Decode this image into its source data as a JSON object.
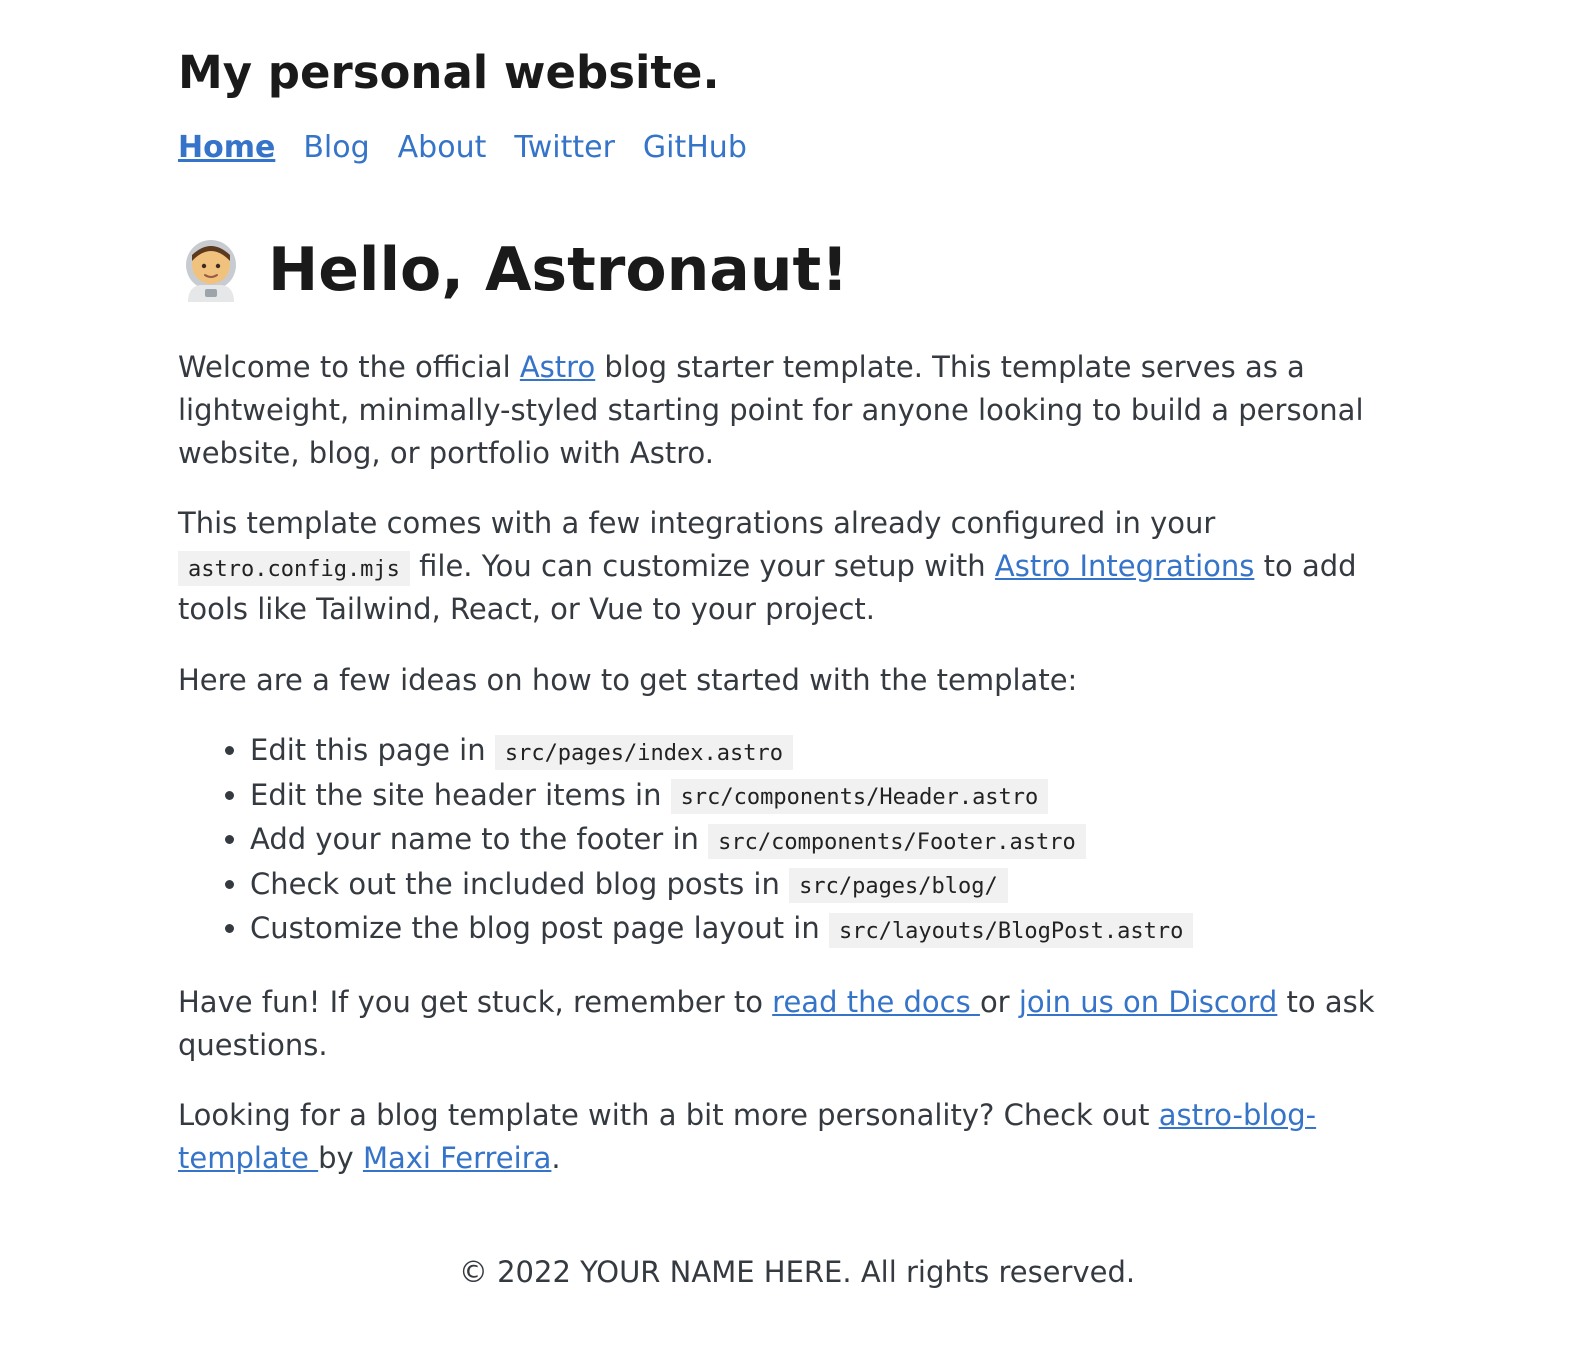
{
  "site": {
    "title": "My personal website."
  },
  "nav": {
    "items": [
      {
        "label": "Home",
        "active": true
      },
      {
        "label": "Blog",
        "active": false
      },
      {
        "label": "About",
        "active": false
      },
      {
        "label": "Twitter",
        "active": false
      },
      {
        "label": "GitHub",
        "active": false
      }
    ],
    "active_color": "#3574c8"
  },
  "hero": {
    "icon": "astronaut-emoji",
    "title": "Hello, Astronaut!"
  },
  "intro": {
    "before_link": "Welcome to the official ",
    "link": "Astro",
    "after_link": " blog starter template. This template serves as a lightweight, minimally-styled starting point for anyone looking to build a personal website, blog, or portfolio with Astro."
  },
  "integrations": {
    "line1": "This template comes with a few integrations already configured in your",
    "code": "astro.config.mjs",
    "middle": " file. You can customize your setup with ",
    "link": "Astro Integrations",
    "after_link": " to add tools like Tailwind, React, or Vue to your project."
  },
  "ideas": {
    "intro": "Here are a few ideas on how to get started with the template:",
    "items": [
      {
        "text": "Edit this page in ",
        "code": "src/pages/index.astro"
      },
      {
        "text": "Edit the site header items in ",
        "code": "src/components/Header.astro"
      },
      {
        "text": "Add your name to the footer in ",
        "code": "src/components/Footer.astro"
      },
      {
        "text": "Check out the included blog posts in ",
        "code": "src/pages/blog/"
      },
      {
        "text": "Customize the blog post page layout in ",
        "code": "src/layouts/BlogPost.astro"
      }
    ]
  },
  "fun": {
    "before_docs": "Have fun! If you get stuck, remember to ",
    "docs_link": "read the docs ",
    "middle": "or ",
    "discord_link": "join us on Discord",
    "after_link": " to ask questions."
  },
  "template": {
    "before_link": "Looking for a blog template with a bit more personality? Check out ",
    "template_link": "astro-blog-template ",
    "by": "by ",
    "author_link": "Maxi Ferreira",
    "end": "."
  },
  "footer": {
    "text": "© 2022 YOUR NAME HERE. All rights reserved."
  }
}
